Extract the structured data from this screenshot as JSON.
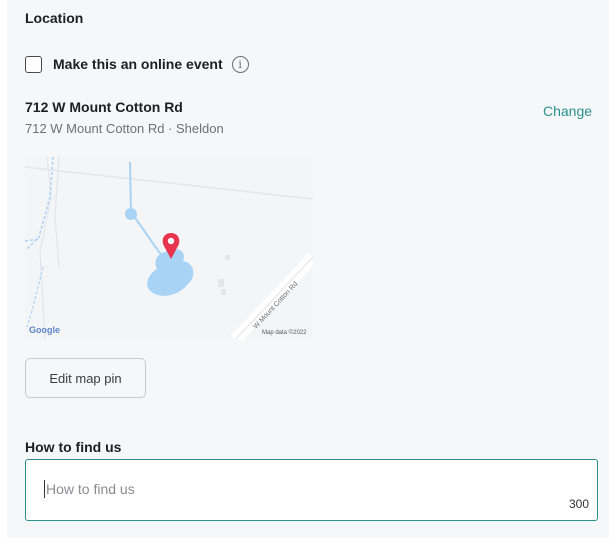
{
  "location": {
    "section_title": "Location",
    "online_event": {
      "label": "Make this an online event",
      "checked": false,
      "info_icon": "info-icon"
    },
    "address": {
      "name": "712 W Mount Cotton Rd",
      "detail": "712 W Mount Cotton Rd · Sheldon",
      "change_label": "Change"
    },
    "map": {
      "road_label": "W Mount Cotton Rd",
      "logo_text": "Google",
      "attribution": "Map data ©2022",
      "pin_icon": "map-pin-icon",
      "colors": {
        "water": "#a9d3f5",
        "pin": "#e8344e",
        "land": "#f4f5f7"
      }
    },
    "edit_pin_label": "Edit map pin",
    "how_to_find": {
      "label": "How to find us",
      "placeholder": "How to find us",
      "value": "",
      "char_limit": "300"
    },
    "colors": {
      "accent": "#2a8f8d",
      "panel_bg": "#f6f7f8"
    }
  }
}
